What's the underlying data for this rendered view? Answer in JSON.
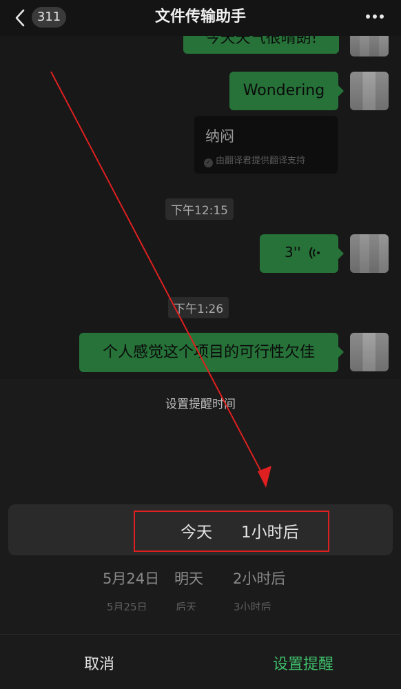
{
  "nav": {
    "back_count": "311",
    "title": "文件传输助手"
  },
  "chat": {
    "top_partial": "今天天气很晴朗!",
    "msg_wondering": "Wondering",
    "translation": {
      "text": "纳闷",
      "note": "由翻译君提供翻译支持"
    },
    "time1": "下午12:15",
    "voice_duration": "3''",
    "time2": "下午1:26",
    "msg_cn": "个人感觉这个项目的可行性欠佳"
  },
  "sheet": {
    "title": "设置提醒时间",
    "selected": {
      "day": "今天",
      "hour": "1小时后"
    },
    "row2": {
      "date": "5月24日",
      "day": "明天",
      "hour": "2小时后"
    },
    "row3": {
      "date": "5月25日",
      "day": "后天",
      "hour": "3小时后"
    },
    "cancel": "取消",
    "confirm": "设置提醒"
  },
  "colors": {
    "bubble_green": "#2f8b45",
    "confirm_green": "#3fbf6b",
    "annotation_red": "#e02020"
  },
  "icons": [
    "back-chevron-icon",
    "more-dots-icon",
    "voice-icon",
    "check-icon"
  ]
}
